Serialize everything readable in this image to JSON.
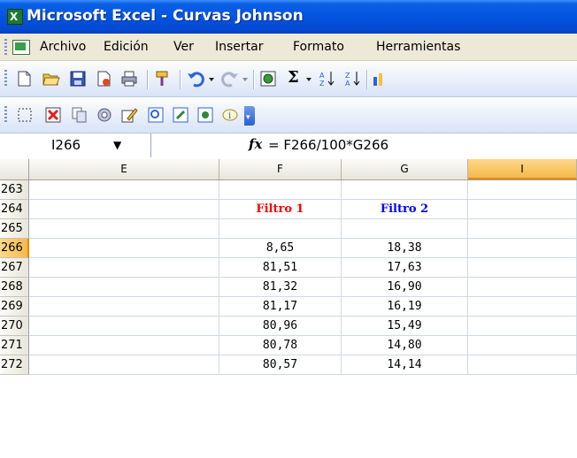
{
  "window": {
    "title": "Microsoft Excel - Curvas Johnson"
  },
  "menu": {
    "items": [
      "Archivo",
      "Edición",
      "Ver",
      "Insertar",
      "Formato",
      "Herramientas"
    ]
  },
  "toolbar1": {
    "icons": [
      "new-icon",
      "open-icon",
      "save-icon",
      "permission-icon",
      "print-icon",
      "format-painter-icon",
      "undo-icon",
      "dropdown-icon",
      "redo-icon",
      "dropdown-icon",
      "insert-hyperlink-icon",
      "autosum-icon",
      "dropdown-icon",
      "sort-ascending-icon",
      "sort-descending-icon",
      "chart-wizard-icon"
    ]
  },
  "toolbar2": {
    "icons": [
      "select-icon",
      "delete-icon",
      "copy-icon",
      "settings-icon",
      "edit-icon",
      "form-icon",
      "edit-box-icon",
      "view-icon",
      "info-icon",
      "toolbar-options-icon"
    ]
  },
  "formula_bar": {
    "name_box": "I266",
    "fx": "fx",
    "formula": "= F266/100*G266"
  },
  "columns": [
    "E",
    "F",
    "G",
    "I"
  ],
  "rows": [
    {
      "num": "263",
      "f": "",
      "g": ""
    },
    {
      "num": "264",
      "f": "Filtro 1",
      "g": "Filtro 2"
    },
    {
      "num": "265",
      "f": "",
      "g": ""
    },
    {
      "num": "266",
      "f": "8,65",
      "g": "18,38"
    },
    {
      "num": "267",
      "f": "81,51",
      "g": "17,63"
    },
    {
      "num": "268",
      "f": "81,32",
      "g": "16,90"
    },
    {
      "num": "269",
      "f": "81,17",
      "g": "16,19"
    },
    {
      "num": "270",
      "f": "80,96",
      "g": "15,49"
    },
    {
      "num": "271",
      "f": "80,78",
      "g": "14,80"
    },
    {
      "num": "272",
      "f": "80,57",
      "g": "14,14"
    }
  ],
  "selected_row": "266",
  "selected_column": "I"
}
